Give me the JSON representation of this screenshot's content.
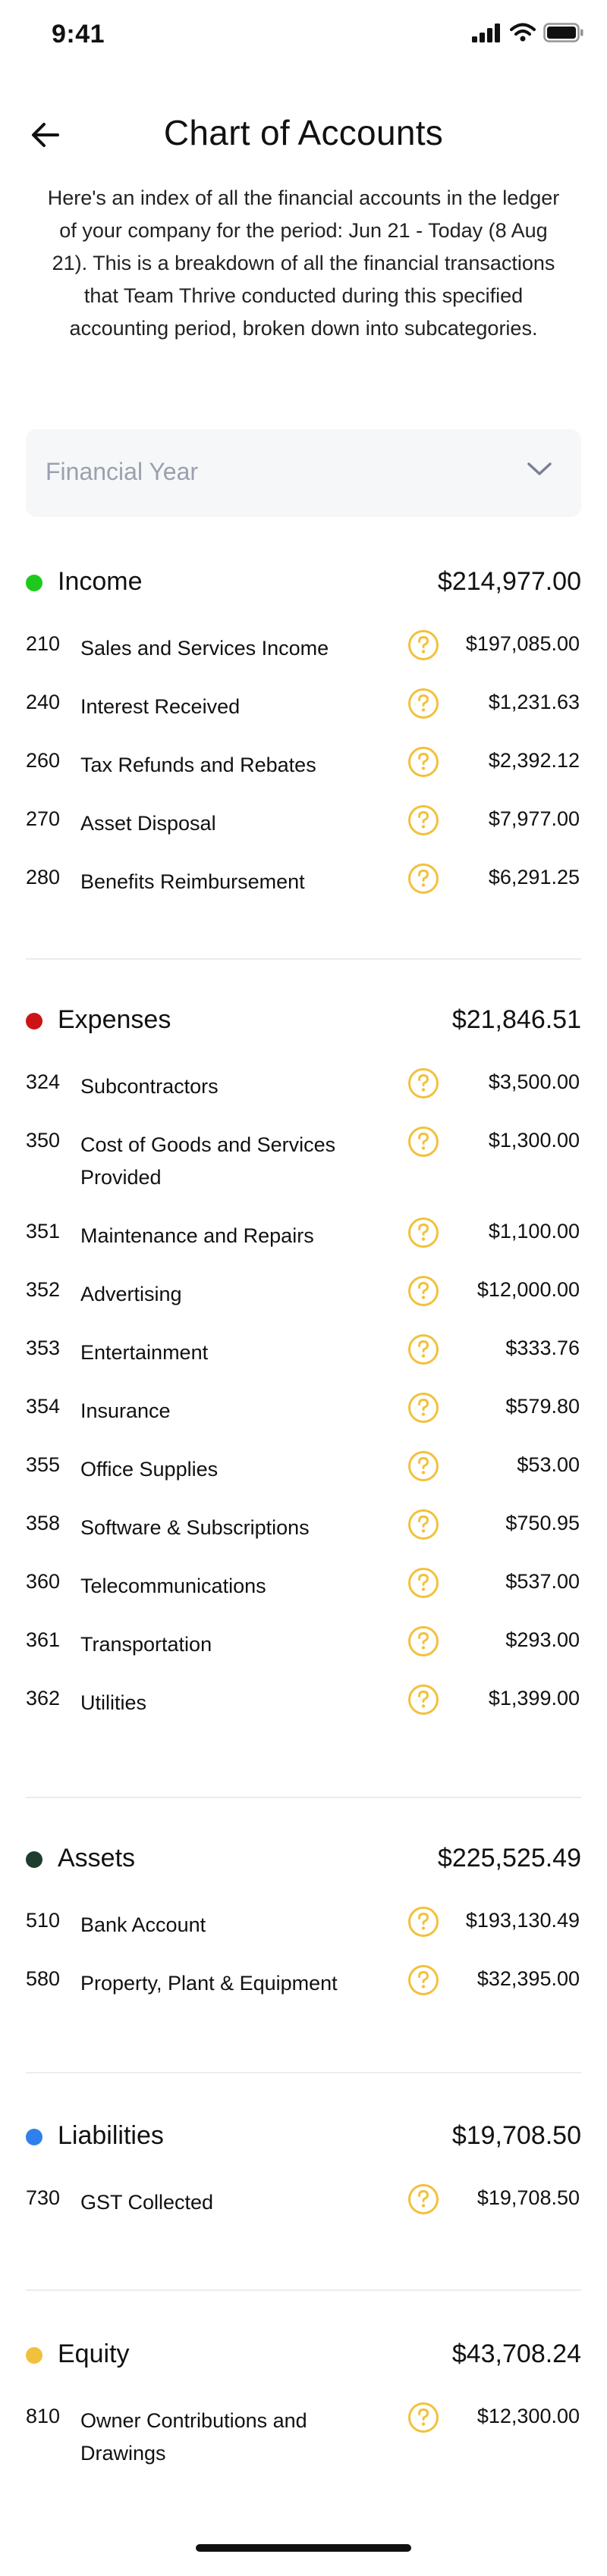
{
  "status_bar": {
    "time": "9:41"
  },
  "header": {
    "title": "Chart of Accounts"
  },
  "intro": "Here's an index of all the financial accounts in the ledger of your company for the period: Jun 21 - Today (8 Aug 21). This is a breakdown of all the financial transactions that Team Thrive conducted during this specified accounting period, broken down into subcategories.",
  "financial_year": {
    "placeholder": "Financial Year"
  },
  "colors": {
    "income": "#1ec91e",
    "expenses": "#cc1414",
    "assets": "#1f3d2f",
    "liabilities": "#2f80ed",
    "equity": "#f2c13c",
    "help": "#f2c13c"
  },
  "sections": [
    {
      "title": "Income",
      "total": "$214,977.00",
      "rows": [
        {
          "code": "210",
          "name": "Sales and Services Income",
          "amount": "$197,085.00"
        },
        {
          "code": "240",
          "name": "Interest Received",
          "amount": "$1,231.63"
        },
        {
          "code": "260",
          "name": "Tax Refunds and Rebates",
          "amount": "$2,392.12"
        },
        {
          "code": "270",
          "name": "Asset Disposal",
          "amount": "$7,977.00"
        },
        {
          "code": "280",
          "name": "Benefits Reimbursement",
          "amount": "$6,291.25"
        }
      ]
    },
    {
      "title": "Expenses",
      "total": "$21,846.51",
      "rows": [
        {
          "code": "324",
          "name": "Subcontractors",
          "amount": "$3,500.00"
        },
        {
          "code": "350",
          "name": "Cost of Goods and Services Provided",
          "amount": "$1,300.00"
        },
        {
          "code": "351",
          "name": "Maintenance and Repairs",
          "amount": "$1,100.00"
        },
        {
          "code": "352",
          "name": "Advertising",
          "amount": "$12,000.00"
        },
        {
          "code": "353",
          "name": "Entertainment",
          "amount": "$333.76"
        },
        {
          "code": "354",
          "name": "Insurance",
          "amount": "$579.80"
        },
        {
          "code": "355",
          "name": "Office Supplies",
          "amount": "$53.00"
        },
        {
          "code": "358",
          "name": "Software & Subscriptions",
          "amount": "$750.95"
        },
        {
          "code": "360",
          "name": "Telecommunications",
          "amount": "$537.00"
        },
        {
          "code": "361",
          "name": "Transportation",
          "amount": "$293.00"
        },
        {
          "code": "362",
          "name": "Utilities",
          "amount": "$1,399.00"
        }
      ]
    },
    {
      "title": "Assets",
      "total": "$225,525.49",
      "rows": [
        {
          "code": "510",
          "name": "Bank Account",
          "amount": "$193,130.49"
        },
        {
          "code": "580",
          "name": "Property, Plant & Equipment",
          "amount": "$32,395.00"
        }
      ]
    },
    {
      "title": "Liabilities",
      "total": "$19,708.50",
      "rows": [
        {
          "code": "730",
          "name": "GST Collected",
          "amount": "$19,708.50"
        }
      ]
    },
    {
      "title": "Equity",
      "total": "$43,708.24",
      "rows": [
        {
          "code": "810",
          "name": "Owner Contributions and Drawings",
          "amount": "$12,300.00"
        }
      ]
    }
  ]
}
